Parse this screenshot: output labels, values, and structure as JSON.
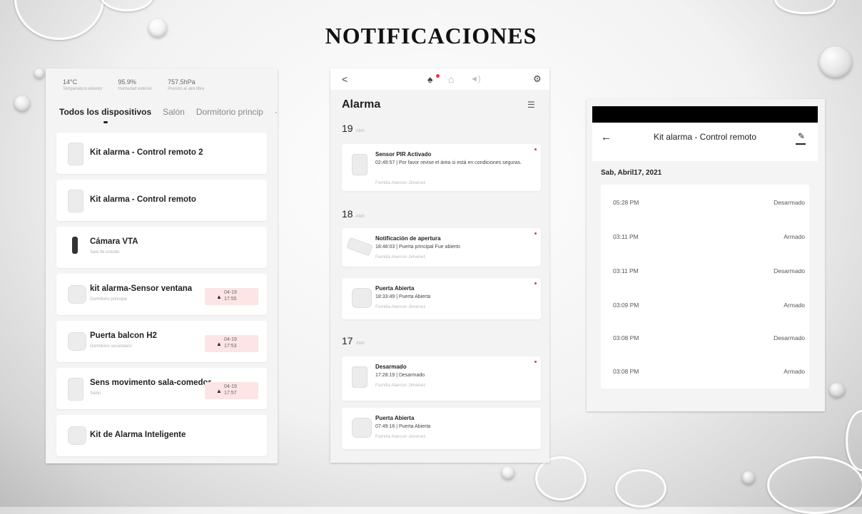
{
  "title": "NOTIFICACIONES",
  "panel1": {
    "stats": [
      {
        "value": "14°C",
        "label": "Temperatura exterior"
      },
      {
        "value": "95.9%",
        "label": "Humedad exterior"
      },
      {
        "value": "757.5hPa",
        "label": "Presión al aire libre"
      }
    ],
    "tabs": [
      "Todos los dispositivos",
      "Salón",
      "Dormitorio princip"
    ],
    "more": "···",
    "devices": [
      {
        "name": "Kit alarma - Control remoto 2",
        "sub": "",
        "icon": "remote-icon"
      },
      {
        "name": "Kit alarma - Control remoto",
        "sub": "",
        "icon": "remote-icon"
      },
      {
        "name": "Cámara VTA",
        "sub": "Sala de estudio",
        "icon": "camera-icon"
      },
      {
        "name": "kit alarma-Sensor ventana",
        "sub": "Dormitorio principal",
        "icon": "sensor-icon",
        "badge": {
          "date": "04-19",
          "time": "17:55"
        }
      },
      {
        "name": "Puerta balcon H2",
        "sub": "Dormitorio secundario",
        "icon": "sensor-icon",
        "badge": {
          "date": "04-19",
          "time": "17:53"
        }
      },
      {
        "name": "Sens movimento sala-comedor",
        "sub": "Salón",
        "icon": "motion-sensor-icon",
        "badge": {
          "date": "04-19",
          "time": "17:57"
        }
      },
      {
        "name": "Kit de Alarma Inteligente",
        "sub": "",
        "icon": "alarm-kit-icon"
      }
    ]
  },
  "panel2": {
    "toolbar": {
      "back": "<",
      "bell": "bell-icon",
      "home": "home-icon",
      "sound": "speaker-icon",
      "settings": "settings-icon"
    },
    "heading": "Alarma",
    "days": [
      {
        "day": "19",
        "month": "Abril"
      },
      {
        "day": "18",
        "month": "Abril"
      },
      {
        "day": "17",
        "month": "Abril"
      }
    ],
    "notifications": [
      {
        "title": "Sensor PIR Activado",
        "detail": "02:49:57 | Por favor revise el área si está en condiciones seguras.",
        "family": "Familia Alarcon Jimenez"
      },
      {
        "title": "Notificación de apertura",
        "detail": "18:48:03 | Puerta principal Fue abierto",
        "family": "Familia Alarcon Jimenez"
      },
      {
        "title": "Puerta Abierta",
        "detail": "18:33:49 | Puerta Abierta",
        "family": "Familia Alarcon Jimenez"
      },
      {
        "title": "Desarmado",
        "detail": "17:28:19 | Desarmado",
        "family": "Familia Alarcon Jimenez"
      },
      {
        "title": "Puerta Abierta",
        "detail": "07:49:16 | Puerta Abierta",
        "family": "Familia Alarcon Jimenez"
      }
    ]
  },
  "panel3": {
    "header_title": "Kit alarma - Control remoto",
    "date": "Sab, Abril17, 2021",
    "rows": [
      {
        "time": "05:28 PM",
        "state": "Desarmado"
      },
      {
        "time": "03:11 PM",
        "state": "Armado"
      },
      {
        "time": "03:11 PM",
        "state": "Desarmado"
      },
      {
        "time": "03:09 PM",
        "state": "Armado"
      },
      {
        "time": "03:08 PM",
        "state": "Desarmado"
      },
      {
        "time": "03:08 PM",
        "state": "Armado"
      }
    ]
  },
  "colors": {
    "accent_red": "#e53935",
    "badge_bg": "#fde5e5"
  }
}
